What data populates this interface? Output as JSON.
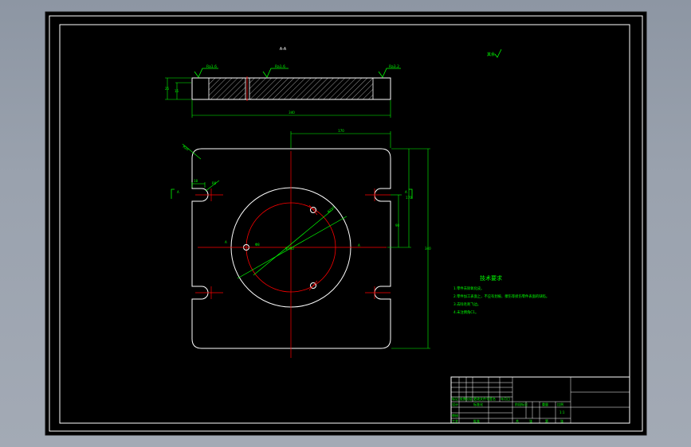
{
  "drawing": {
    "section_label": "A-A",
    "roughness_other": "其余",
    "roughness_top_left": "Ra1.6",
    "roughness_top_mid": "Ra1.6",
    "roughness_top_right": "Ra3.2",
    "dim_thickness": "25",
    "dim_inner": "15",
    "dim_overall_width": "340",
    "dim_half_width": "170",
    "dim_half_height": "170",
    "dim_height": "340",
    "dim_corner_radius": "R20",
    "dim_slot_width": "18",
    "dim_slot_radius": "R9",
    "dim_slot_offset": "45",
    "dim_slot_pitch": "90",
    "dim_bolt_circle": "Φ250",
    "dim_hole": "Φ8",
    "dim_boss": "Φ350",
    "view_marker": "A"
  },
  "notes": {
    "title": "技术要求",
    "line1": "1.零件去除氧化皮。",
    "line2": "2.零件加工表面上，不应有划痕、擦伤等损伤零件表面的缺陷。",
    "line3": "3.去除毛刺飞边。",
    "line4": "4.未注倒角C1。"
  },
  "title_block": {
    "cell_mark": "标记",
    "cell_count": "处数",
    "cell_zone": "分区",
    "cell_docno": "更改文件号",
    "cell_sign": "签名",
    "cell_date": "年月日",
    "cell_designer": "设计",
    "cell_std": "标准化",
    "cell_stage": "阶段标记",
    "cell_weight": "重量",
    "cell_scale": "比例",
    "cell_scale_value": "1:1",
    "cell_review": "审核",
    "cell_process": "工艺",
    "cell_approve": "批准",
    "cell_total": "共",
    "cell_sheet_label": "张",
    "cell_nth": "第"
  },
  "colors": {
    "background": "#000000",
    "geometry": "#ffffff",
    "dimension": "#00ff00",
    "centerline": "#ff0000",
    "hatch": "#ffffff",
    "window": "#9aa2ae"
  }
}
